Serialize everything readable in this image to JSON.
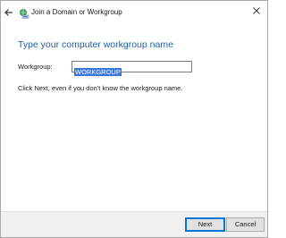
{
  "window": {
    "title": "Join a Domain or Workgroup"
  },
  "icons": {
    "back": "back-arrow-icon",
    "app": "network-workgroup-icon",
    "close": "close-icon"
  },
  "main": {
    "heading": "Type your computer workgroup name",
    "field_label": "Workgroup:",
    "field_value": "WORKGROUP",
    "hint": "Click Next, even if you don't know the workgroup name."
  },
  "footer": {
    "next_label": "Next",
    "cancel_label": "Cancel"
  },
  "colors": {
    "heading": "#1f5fa8",
    "selection": "#3b77d8",
    "primary_border": "#0078d7"
  }
}
